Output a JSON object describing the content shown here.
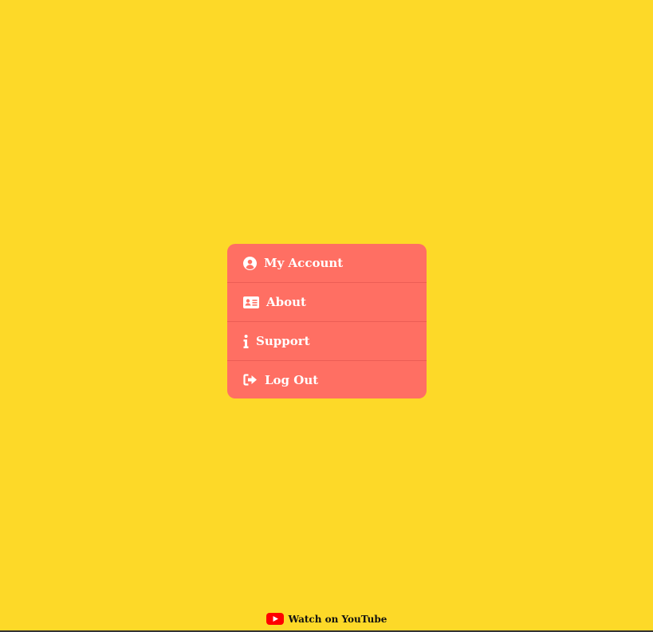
{
  "colors": {
    "background": "#fdd928",
    "menu_background": "#ff6f63",
    "menu_text": "#ffffff",
    "youtube_red": "#ff0000"
  },
  "menu": {
    "items": [
      {
        "label": "My Account",
        "icon": "user-circle-icon"
      },
      {
        "label": "About",
        "icon": "id-card-icon"
      },
      {
        "label": "Support",
        "icon": "info-icon"
      },
      {
        "label": "Log Out",
        "icon": "sign-out-icon"
      }
    ]
  },
  "footer": {
    "link_label": "Watch on YouTube",
    "icon": "youtube-icon"
  }
}
